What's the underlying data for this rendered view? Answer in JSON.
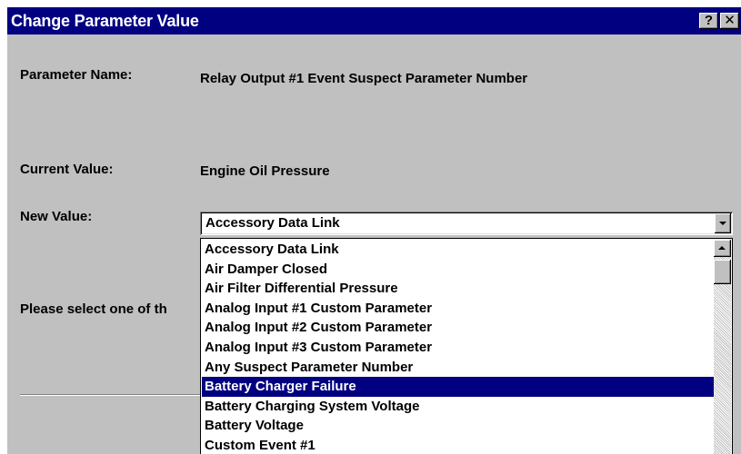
{
  "dialog": {
    "title": "Change Parameter Value",
    "help_button": "?",
    "close_button": "✕"
  },
  "labels": {
    "parameter_name": "Parameter Name:",
    "current_value": "Current Value:",
    "new_value": "New Value:",
    "instruction": "Please select one of th"
  },
  "values": {
    "parameter_name": "Relay Output #1 Event Suspect Parameter Number",
    "current_value": "Engine Oil Pressure"
  },
  "combo": {
    "selected": "Accessory Data Link"
  },
  "dropdown": {
    "items": [
      "Accessory Data Link",
      "Air Damper Closed",
      "Air Filter Differential Pressure",
      "Analog Input #1 Custom Parameter",
      "Analog Input #2 Custom Parameter",
      "Analog Input #3 Custom Parameter",
      "Any Suspect Parameter Number",
      "Battery Charger Failure",
      "Battery Charging System Voltage",
      "Battery Voltage",
      "Custom Event #1"
    ],
    "highlighted_index": 7
  },
  "colors": {
    "title_bar": "#000080",
    "dialog_bg": "#c0c0c0",
    "highlight": "#000080"
  }
}
